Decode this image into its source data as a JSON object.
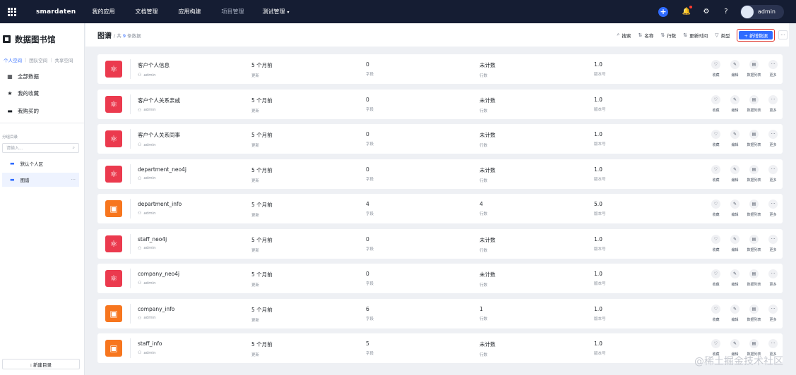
{
  "topbar": {
    "logo": "smardaten",
    "nav": [
      {
        "label": "我的应用",
        "muted": false
      },
      {
        "label": "文档管理",
        "muted": false
      },
      {
        "label": "应用构建",
        "muted": false
      },
      {
        "label": "项目管理",
        "muted": true
      },
      {
        "label": "测试管理",
        "muted": false,
        "caret": "▾"
      }
    ],
    "plus": "+",
    "icons": [
      "bell-icon",
      "gear-icon",
      "help-icon"
    ],
    "bell": "🔔",
    "gear": "⚙",
    "help": "?",
    "user": "admin"
  },
  "sidebar": {
    "title": "数据图书馆",
    "tabs": [
      "个人空间",
      "团队空间",
      "共享空间"
    ],
    "menu": [
      {
        "icon": "▦",
        "label": "全部数据"
      },
      {
        "icon": "★",
        "label": "我的收藏"
      },
      {
        "icon": "▬",
        "label": "我购买的"
      }
    ],
    "section": "分组目录",
    "search_placeholder": "请输入...",
    "search_icon": "⌕",
    "folders": [
      {
        "icon": "▬",
        "label": "默认个人区"
      },
      {
        "icon": "▬",
        "label": "图谱",
        "more": "···"
      }
    ],
    "new_button": "⁝ 新建目录"
  },
  "header": {
    "title": "图谱",
    "count_prefix": "/ 共",
    "count": "9",
    "count_suffix": "条数据",
    "tools": [
      {
        "icon": "⌕",
        "label": "搜索"
      },
      {
        "icon": "⇅",
        "label": "名称"
      },
      {
        "icon": "⇅",
        "label": "行数"
      },
      {
        "icon": "⇅",
        "label": "更新时间"
      },
      {
        "icon": "▽",
        "label": "类型"
      }
    ],
    "add_button": "+ 新增数据",
    "more": "···"
  },
  "labels": {
    "updated": "更新",
    "fields": "字段",
    "rows": "行数",
    "version": "版本号",
    "owner_icon": "⚇"
  },
  "action_labels": [
    {
      "icon": "♡",
      "label": "收藏"
    },
    {
      "icon": "✎",
      "label": "编辑"
    },
    {
      "icon": "▤",
      "label": "数据列表"
    },
    {
      "icon": "···",
      "label": "更多"
    }
  ],
  "rows": [
    {
      "name": "客户个人信息",
      "owner": "admin",
      "updated": "5 个月前",
      "fields": "0",
      "rows": "未计数",
      "version": "1.0",
      "kind": "graph"
    },
    {
      "name": "客户个人关系亲戚",
      "owner": "admin",
      "updated": "5 个月前",
      "fields": "0",
      "rows": "未计数",
      "version": "1.0",
      "kind": "graph"
    },
    {
      "name": "客户个人关系同事",
      "owner": "admin",
      "updated": "5 个月前",
      "fields": "0",
      "rows": "未计数",
      "version": "1.0",
      "kind": "graph"
    },
    {
      "name": "department_neo4j",
      "owner": "admin",
      "updated": "5 个月前",
      "fields": "0",
      "rows": "未计数",
      "version": "1.0",
      "kind": "graph"
    },
    {
      "name": "department_info",
      "owner": "admin",
      "updated": "5 个月前",
      "fields": "4",
      "rows": "4",
      "version": "5.0",
      "kind": "table"
    },
    {
      "name": "staff_neo4j",
      "owner": "admin",
      "updated": "5 个月前",
      "fields": "0",
      "rows": "未计数",
      "version": "1.0",
      "kind": "graph"
    },
    {
      "name": "company_neo4j",
      "owner": "admin",
      "updated": "5 个月前",
      "fields": "0",
      "rows": "未计数",
      "version": "1.0",
      "kind": "graph"
    },
    {
      "name": "company_info",
      "owner": "admin",
      "updated": "5 个月前",
      "fields": "6",
      "rows": "1",
      "version": "1.0",
      "kind": "table"
    },
    {
      "name": "staff_info",
      "owner": "admin",
      "updated": "5 个月前",
      "fields": "5",
      "rows": "未计数",
      "version": "1.0",
      "kind": "table"
    }
  ],
  "kind_icons": {
    "graph": "⚛",
    "table": "▣"
  },
  "watermark": "@稀土掘金技术社区"
}
